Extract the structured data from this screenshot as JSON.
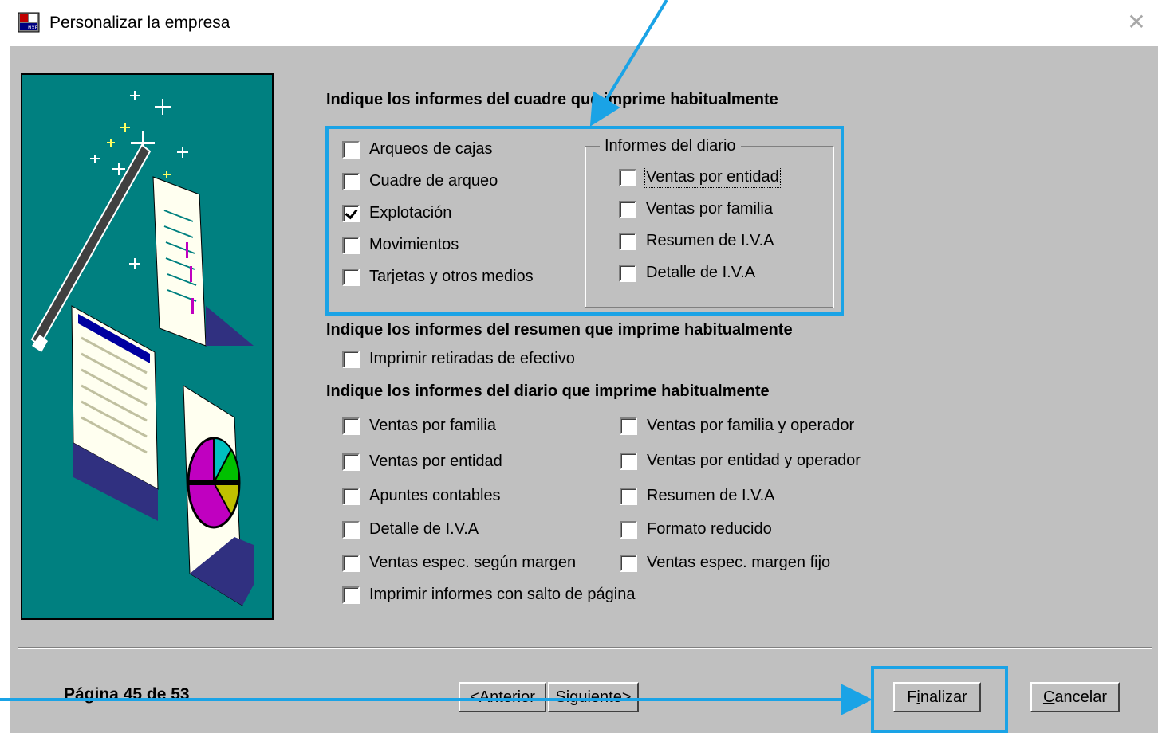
{
  "window": {
    "title": "Personalizar la empresa",
    "close_glyph": "✕"
  },
  "section_cuadre": {
    "heading": "Indique los informes del cuadre que imprime habitualmente",
    "items": [
      {
        "label": "Arqueos de cajas",
        "checked": false
      },
      {
        "label": "Cuadre de arqueo",
        "checked": false
      },
      {
        "label": "Explotación",
        "checked": true
      },
      {
        "label": "Movimientos",
        "checked": false
      },
      {
        "label": "Tarjetas y otros medios",
        "checked": false
      }
    ],
    "group_title": "Informes del diario",
    "group_items": [
      {
        "label": "Ventas por entidad",
        "checked": false,
        "focused": true
      },
      {
        "label": "Ventas por familia",
        "checked": false
      },
      {
        "label": "Resumen de I.V.A",
        "checked": false
      },
      {
        "label": "Detalle de I.V.A",
        "checked": false
      }
    ]
  },
  "section_resumen": {
    "heading": "Indique los informes del resumen que imprime habitualmente",
    "items": [
      {
        "label": "Imprimir retiradas de efectivo",
        "checked": false
      }
    ]
  },
  "section_diario": {
    "heading": "Indique los informes del diario que imprime habitualmente",
    "left_items": [
      {
        "label": "Ventas por familia",
        "checked": false
      },
      {
        "label": "Ventas por entidad",
        "checked": false
      },
      {
        "label": "Apuntes contables",
        "checked": false
      },
      {
        "label": "Detalle de I.V.A",
        "checked": false
      },
      {
        "label": "Ventas espec. según margen",
        "checked": false
      },
      {
        "label": "Imprimir informes con salto de página",
        "checked": false
      }
    ],
    "right_items": [
      {
        "label": "Ventas por familia y operador",
        "checked": false
      },
      {
        "label": "Ventas por entidad y operador",
        "checked": false
      },
      {
        "label": "Resumen de I.V.A",
        "checked": false
      },
      {
        "label": "Formato reducido",
        "checked": false
      },
      {
        "label": "Ventas espec. margen fijo",
        "checked": false
      }
    ]
  },
  "footer": {
    "page_label": "Página 45 de 53",
    "prev_label": "<Anterior",
    "next_label": "Siguiente>",
    "finish_pre": "F",
    "finish_mnemonic": "i",
    "finish_post": "nalizar",
    "cancel_mnemonic": "C",
    "cancel_post": "ancelar"
  },
  "annotations": {
    "highlight_color": "#1aa3e6"
  },
  "colors": {
    "dialog_bg": "#c0c0c0",
    "wizard_bg": "#008080"
  }
}
